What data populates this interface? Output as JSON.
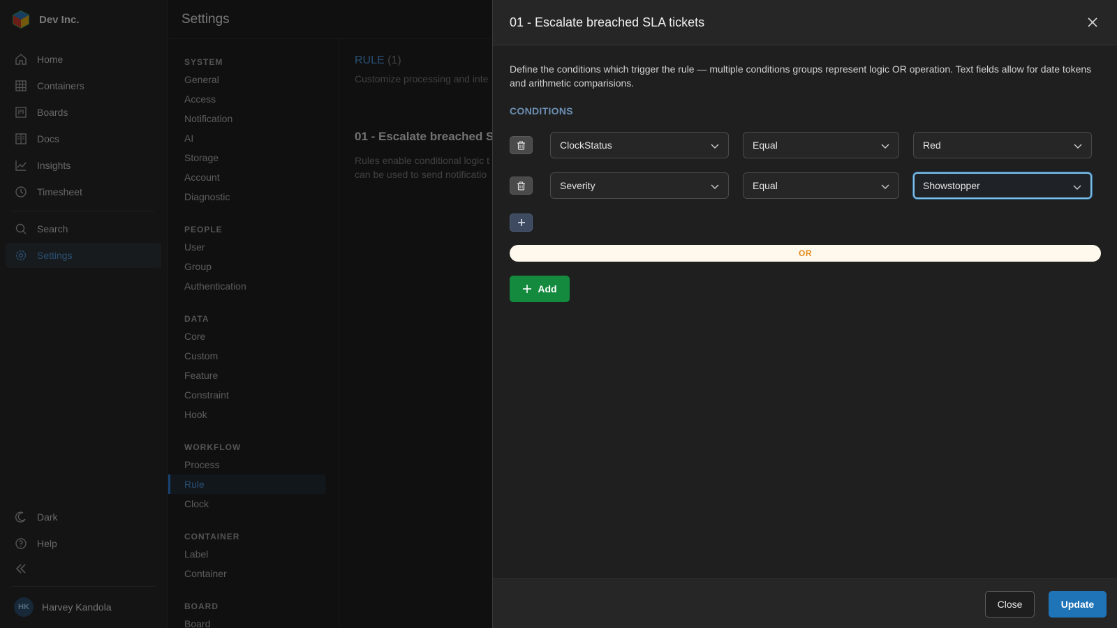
{
  "app": {
    "org_name": "Dev Inc.",
    "page_title": "Settings"
  },
  "sidebar": {
    "items": [
      {
        "label": "Home",
        "icon": "home-icon"
      },
      {
        "label": "Containers",
        "icon": "grid-icon"
      },
      {
        "label": "Boards",
        "icon": "board-icon"
      },
      {
        "label": "Docs",
        "icon": "docs-icon"
      },
      {
        "label": "Insights",
        "icon": "chart-icon"
      },
      {
        "label": "Timesheet",
        "icon": "clock-icon"
      },
      {
        "label": "Search",
        "icon": "search-icon"
      },
      {
        "label": "Settings",
        "icon": "gear-icon"
      }
    ],
    "theme_label": "Dark",
    "help_label": "Help",
    "user": {
      "initials": "HK",
      "name": "Harvey Kandola"
    }
  },
  "settings_nav": {
    "sections": [
      {
        "title": "SYSTEM",
        "items": [
          "General",
          "Access",
          "Notification",
          "AI",
          "Storage",
          "Account",
          "Diagnostic"
        ]
      },
      {
        "title": "PEOPLE",
        "items": [
          "User",
          "Group",
          "Authentication"
        ]
      },
      {
        "title": "DATA",
        "items": [
          "Core",
          "Custom",
          "Feature",
          "Constraint",
          "Hook"
        ]
      },
      {
        "title": "WORKFLOW",
        "items": [
          "Process",
          "Rule",
          "Clock"
        ]
      },
      {
        "title": "CONTAINER",
        "items": [
          "Label",
          "Container"
        ]
      },
      {
        "title": "BOARD",
        "items": [
          "Board"
        ]
      }
    ],
    "active_item": "Rule"
  },
  "content": {
    "heading": "RULE",
    "count": "(1)",
    "subtitle": "Customize processing and inte",
    "rule_title": "01 - Escalate breached SL",
    "rule_desc_line1": "Rules enable conditional logic t",
    "rule_desc_line2": "can be used to send notificatio"
  },
  "drawer": {
    "title": "01 - Escalate breached SLA tickets",
    "description": "Define the conditions which trigger the rule — multiple conditions groups represent logic OR operation. Text fields allow for date tokens and arithmetic comparisions.",
    "conditions_label": "CONDITIONS",
    "conditions": [
      {
        "field": "ClockStatus",
        "operator": "Equal",
        "value": "Red"
      },
      {
        "field": "Severity",
        "operator": "Equal",
        "value": "Showstopper"
      }
    ],
    "or_label": "OR",
    "add_label": "Add",
    "close_label": "Close",
    "update_label": "Update"
  },
  "colors": {
    "accent": "#1f73b7",
    "add_green": "#138a3e",
    "or_text": "#e58a1c",
    "or_bg": "#fff8ec",
    "focus_ring": "#7fc0ea"
  }
}
